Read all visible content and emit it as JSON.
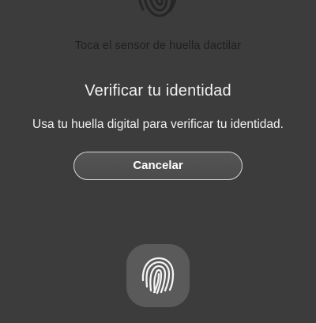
{
  "background": {
    "hint_text": "Toca el sensor de huella dactilar",
    "icon": "fingerprint-icon"
  },
  "dialog": {
    "title": "Verificar tu identidad",
    "message": "Usa tu huella digital para verificar tu identidad.",
    "cancel_label": "Cancelar"
  },
  "sensor": {
    "icon": "fingerprint-icon"
  },
  "colors": {
    "background": "#3c3c3c",
    "text": "#f2f2f2",
    "button_border": "#d8d8d8",
    "sensor_bg": "#5a5a5a"
  }
}
